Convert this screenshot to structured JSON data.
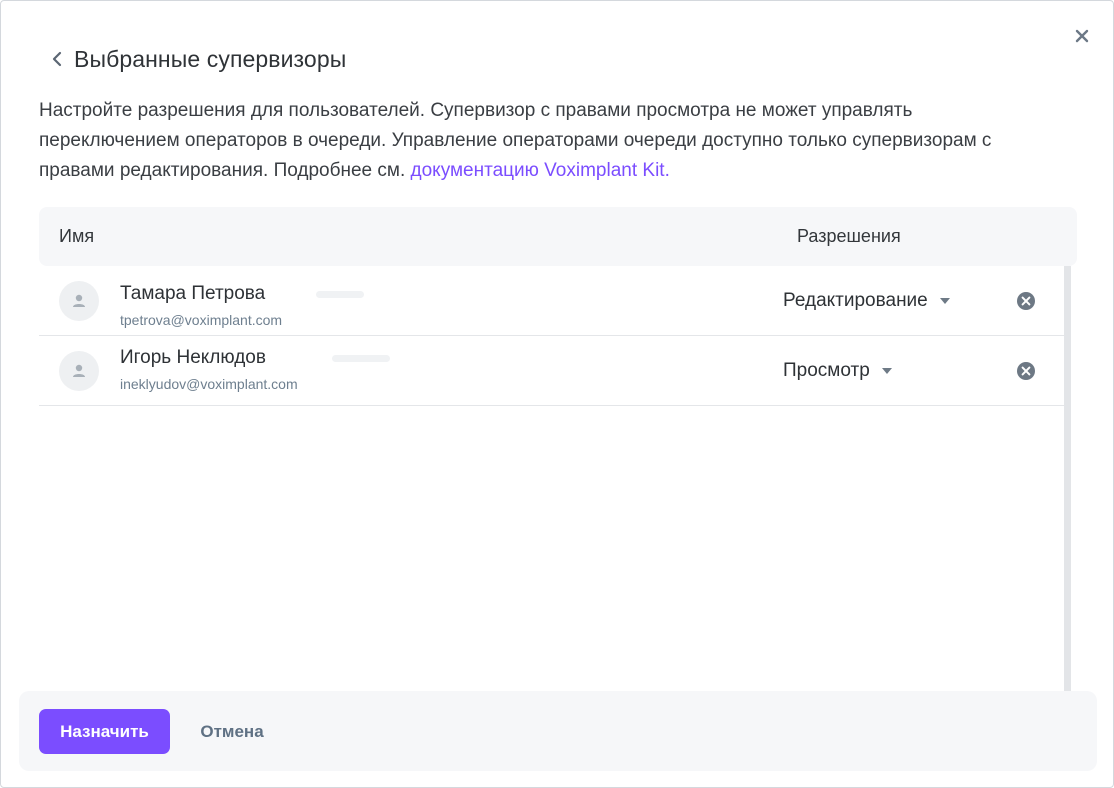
{
  "dialog": {
    "title": "Выбранные супервизоры",
    "description_text": "Настройте разрешения для пользователей. Супервизор с правами просмотра не может управлять переключением операторов в очереди. Управление операторами очереди доступно только супервизорам с правами редактирования. Подробнее см. ",
    "description_link": "документацию Voximplant Kit.",
    "icons": {
      "back": "chevron-left-icon",
      "close": "close-icon"
    }
  },
  "colors": {
    "accent": "#7b4dff",
    "secondary_text": "#6e7f8f"
  },
  "table": {
    "columns": {
      "name": "Имя",
      "permissions": "Разрешения"
    },
    "rows": [
      {
        "name": "Тамара Петрова",
        "email": "tpetrova@voximplant.com",
        "permission": "Редактирование",
        "avatar_icon": "user-icon",
        "remove_icon": "close-circle-icon"
      },
      {
        "name": "Игорь Неклюдов",
        "email": "ineklyudov@voximplant.com",
        "permission": "Просмотр",
        "avatar_icon": "user-icon",
        "remove_icon": "close-circle-icon"
      }
    ]
  },
  "footer": {
    "assign_label": "Назначить",
    "cancel_label": "Отмена"
  }
}
